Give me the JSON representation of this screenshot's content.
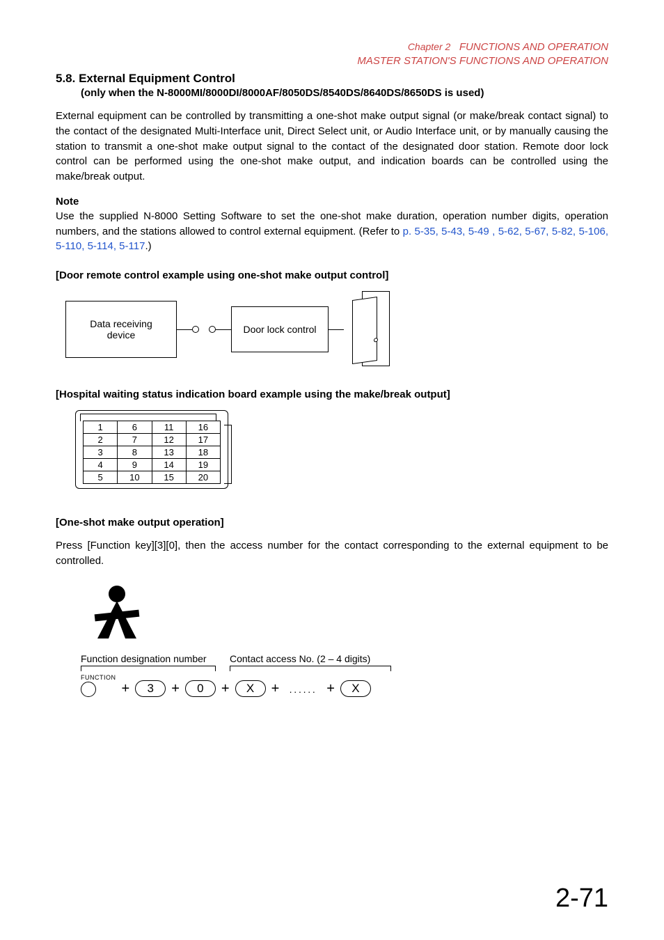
{
  "header": {
    "chapter_label": "Chapter 2",
    "chapter_title": "FUNCTIONS AND OPERATION",
    "subtitle": "MASTER STATION'S FUNCTIONS AND OPERATION"
  },
  "section": {
    "number_title": "5.8. External Equipment Control",
    "condition": "(only when the N-8000MI/8000DI/8000AF/8050DS/8540DS/8640DS/8650DS is used)"
  },
  "paragraph_main": "External equipment can be controlled by transmitting a one-shot make output signal (or make/break contact signal) to the contact of the designated Multi-Interface unit, Direct Select unit, or Audio Interface unit, or by manually causing the station to transmit a one-shot make output signal to the contact of the designated door station. Remote door lock control can be performed using the one-shot make output, and indication boards can be controlled using the make/break output.",
  "note": {
    "label": "Note",
    "text_prefix": "Use the supplied N-8000 Setting Software to set the one-shot make duration, operation number digits, operation numbers, and the stations allowed to control external equipment. (Refer to ",
    "links": "p. 5-35, 5-43, 5-49 , 5-62, 5-67, 5-82, 5-106, 5-110, 5-114, 5-117",
    "text_suffix": ".)"
  },
  "subhead1": "[Door remote control example using one-shot make output control]",
  "diagram1": {
    "box1": "Data receiving device",
    "box2": "Door lock control"
  },
  "subhead2": "[Hospital waiting status indication board example using the make/break output]",
  "board_numbers": [
    [
      "1",
      "6",
      "11",
      "16"
    ],
    [
      "2",
      "7",
      "12",
      "17"
    ],
    [
      "3",
      "8",
      "13",
      "18"
    ],
    [
      "4",
      "9",
      "14",
      "19"
    ],
    [
      "5",
      "10",
      "15",
      "20"
    ]
  ],
  "subhead3": "[One-shot make output operation]",
  "op_instruction": "Press [Function key][3][0], then the access number for the contact corresponding to the external equipment to be controlled.",
  "keyseq": {
    "group1_label": "Function designation number",
    "group2_label": "Contact access No. (2 – 4 digits)",
    "function_label": "FUNCTION",
    "k3": "3",
    "k0": "0",
    "kx1": "X",
    "kx2": "X",
    "dots": "······"
  },
  "page_number": "2-71"
}
